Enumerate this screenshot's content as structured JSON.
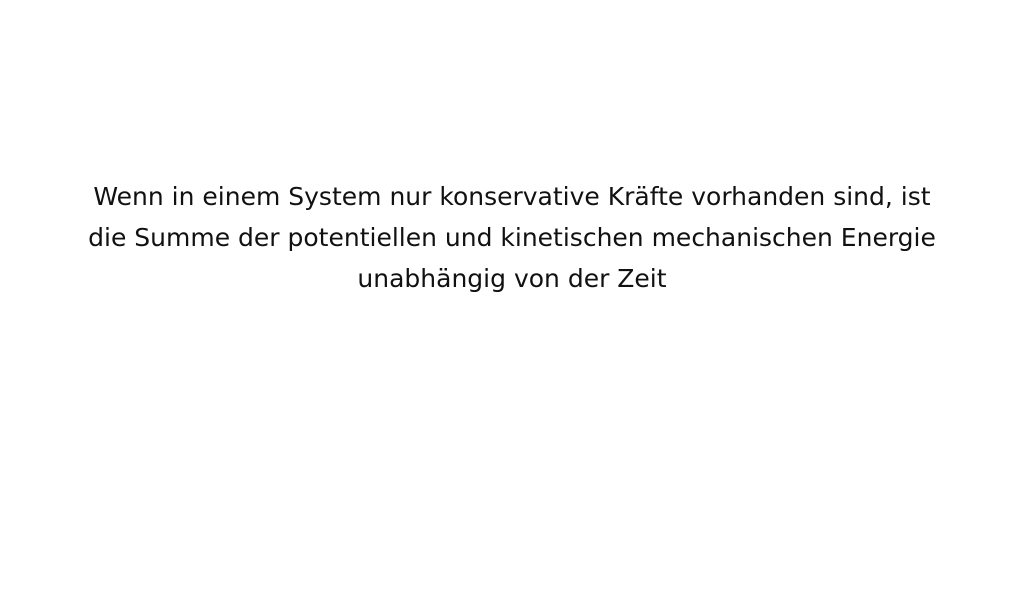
{
  "content": {
    "lines": [
      "Wenn in einem System nur konservative Kräfte vorhanden sind, ist",
      "die Summe der potentiellen und kinetischen mechanischen Energie",
      "unabhängig von der Zeit"
    ]
  }
}
